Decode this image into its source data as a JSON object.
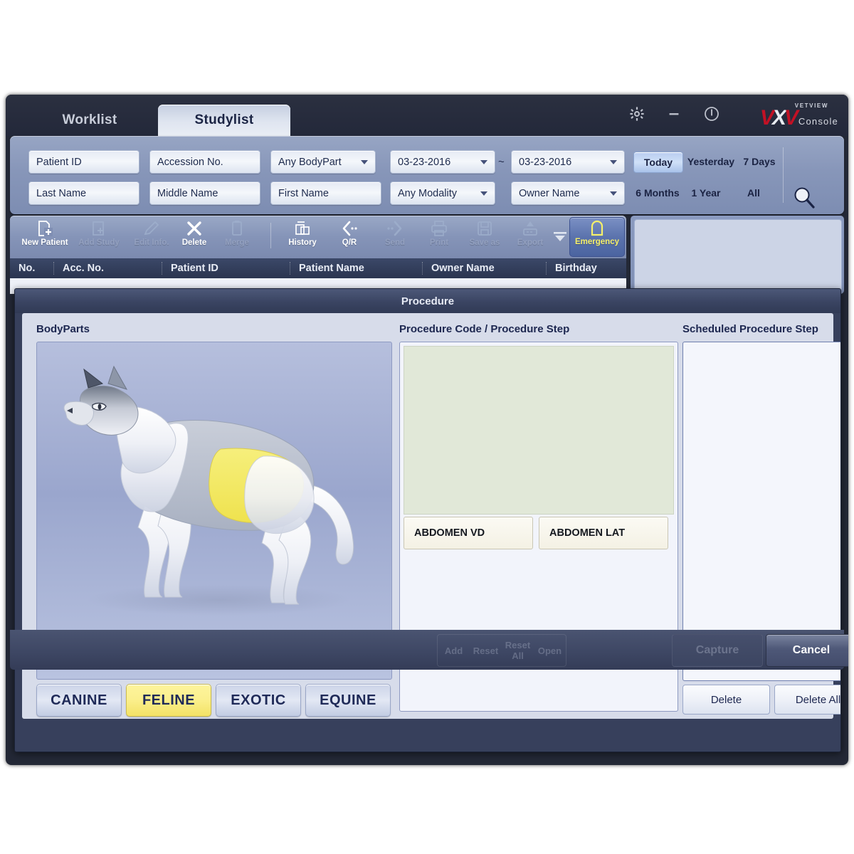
{
  "window": {
    "tabs": [
      {
        "label": "Worklist",
        "active": false
      },
      {
        "label": "Studylist",
        "active": true
      }
    ],
    "controls": [
      {
        "name": "settings",
        "icon": "gear-icon"
      },
      {
        "name": "minimize",
        "icon": "minimize-icon"
      },
      {
        "name": "power",
        "icon": "power-icon"
      }
    ],
    "logo": {
      "superscript": "VETVIEW",
      "mark_left": "V",
      "mark_mid": "X",
      "mark_right": "V",
      "suffix": "Console",
      "red": "#c21125",
      "white": "#e9ecf2"
    }
  },
  "search": {
    "row1": [
      {
        "name": "patient-id",
        "value": "Patient ID",
        "dropdown": false
      },
      {
        "name": "accession-no",
        "value": "Accession No.",
        "dropdown": false
      },
      {
        "name": "bodypart",
        "value": "Any BodyPart",
        "dropdown": true
      },
      {
        "name": "date-from",
        "value": "03-23-2016",
        "dropdown": true
      },
      {
        "name": "date-to",
        "value": "03-23-2016",
        "dropdown": true
      }
    ],
    "row2": [
      {
        "name": "last-name",
        "value": "Last Name",
        "dropdown": false
      },
      {
        "name": "middle-name",
        "value": "Middle Name",
        "dropdown": false
      },
      {
        "name": "first-name",
        "value": "First Name",
        "dropdown": false
      },
      {
        "name": "modality",
        "value": "Any Modality",
        "dropdown": true
      },
      {
        "name": "owner-name",
        "value": "Owner Name",
        "dropdown": true
      }
    ],
    "range_separator": "~",
    "quick_ranges": [
      {
        "label": "Today",
        "active": true
      },
      {
        "label": "Yesterday",
        "active": false
      },
      {
        "label": "7 Days",
        "active": false
      },
      {
        "label": "6 Months",
        "active": false
      },
      {
        "label": "1 Year",
        "active": false
      },
      {
        "label": "All",
        "active": false
      }
    ],
    "search_button": "Search"
  },
  "toolbar": {
    "items": [
      {
        "label": "New Patient",
        "icon": "new-patient-icon",
        "enabled": true
      },
      {
        "label": "Add Study",
        "icon": "add-study-icon",
        "enabled": false
      },
      {
        "label": "Edit Info.",
        "icon": "edit-info-icon",
        "enabled": false
      },
      {
        "label": "Delete",
        "icon": "delete-x-icon",
        "enabled": true
      },
      {
        "label": "Merge",
        "icon": "merge-icon",
        "enabled": false
      },
      {
        "label": "History",
        "icon": "history-icon",
        "enabled": true
      },
      {
        "label": "Q/R",
        "icon": "query-retrieve-icon",
        "enabled": true
      },
      {
        "label": "Send",
        "icon": "send-icon",
        "enabled": false
      },
      {
        "label": "Print",
        "icon": "printer-icon",
        "enabled": false
      },
      {
        "label": "Save as",
        "icon": "floppy-save-icon",
        "enabled": false
      },
      {
        "label": "Export",
        "icon": "export-icon",
        "enabled": false
      }
    ],
    "more_icon": "chevron-down-icon",
    "emergency": {
      "label": "Emergency",
      "icon": "emergency-bell-icon",
      "accent": "#f6f06a"
    }
  },
  "studylist": {
    "columns": [
      "No.",
      "Acc. No.",
      "Patient ID",
      "Patient Name",
      "Owner Name",
      "Birthday"
    ],
    "rows": []
  },
  "dialog": {
    "title": "Procedure",
    "bodyparts": {
      "label": "BodyParts",
      "selected_region": "ABDOMEN",
      "highlight_color": "#f2e45c",
      "species": [
        {
          "label": "CANINE",
          "selected": false
        },
        {
          "label": "FELINE",
          "selected": true
        },
        {
          "label": "EXOTIC",
          "selected": false
        },
        {
          "label": "EQUINE",
          "selected": false
        }
      ]
    },
    "procedure_code": {
      "label": "Procedure Code / Procedure Step",
      "items": [
        "ABDOMEN VD",
        "ABDOMEN LAT"
      ]
    },
    "scheduled": {
      "label": "Scheduled Procedure Step",
      "items": [],
      "buttons": [
        "Delete",
        "Delete All"
      ]
    }
  },
  "bottom": {
    "ghost_buttons": [
      "Add",
      "Reset",
      "Reset All",
      "Open"
    ],
    "capture": "Capture",
    "cancel": "Cancel"
  }
}
